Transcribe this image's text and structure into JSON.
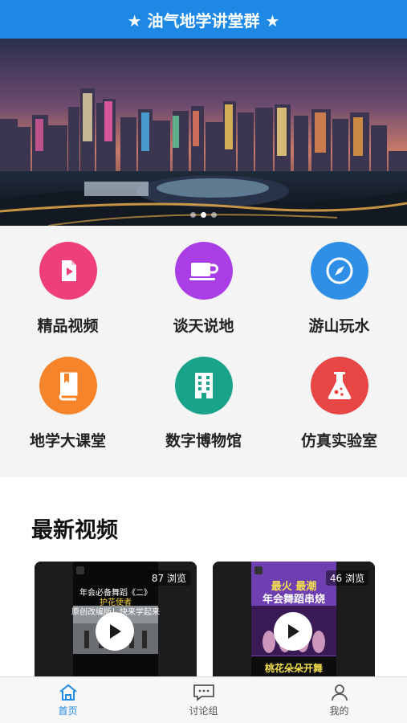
{
  "header": {
    "title": "★ 油气地学讲堂群 ★"
  },
  "banner": {
    "slide_count": 3,
    "active_slide": 1
  },
  "features": [
    {
      "label": "精品视频",
      "icon": "video-icon",
      "color": "#ef3f7a"
    },
    {
      "label": "谈天说地",
      "icon": "coffee-cup-icon",
      "color": "#a93de6"
    },
    {
      "label": "游山玩水",
      "icon": "compass-icon",
      "color": "#2f8fe6"
    },
    {
      "label": "地学大课堂",
      "icon": "book-icon",
      "color": "#f5842a"
    },
    {
      "label": "数字博物馆",
      "icon": "building-icon",
      "color": "#19a38a"
    },
    {
      "label": "仿真实验室",
      "icon": "flask-icon",
      "color": "#e84545"
    }
  ],
  "latest": {
    "title": "最新视频",
    "videos": [
      {
        "views": "87 浏览",
        "caption_lines": [
          "年会必备舞蹈《二》",
          "护花使者",
          "原创改编版！快来学起来"
        ],
        "bottom_caption": ""
      },
      {
        "views": "46 浏览",
        "caption_lines": [
          "最火 最潮",
          "年会舞蹈串烧"
        ],
        "bottom_caption": "桃花朵朵开舞"
      }
    ]
  },
  "tabbar": {
    "items": [
      {
        "label": "首页",
        "icon": "home-icon",
        "active": true
      },
      {
        "label": "讨论组",
        "icon": "chat-icon",
        "active": false
      },
      {
        "label": "我的",
        "icon": "user-icon",
        "active": false
      }
    ]
  },
  "colors": {
    "primary": "#1e88e5",
    "grid_background": "#f4f4f4"
  }
}
